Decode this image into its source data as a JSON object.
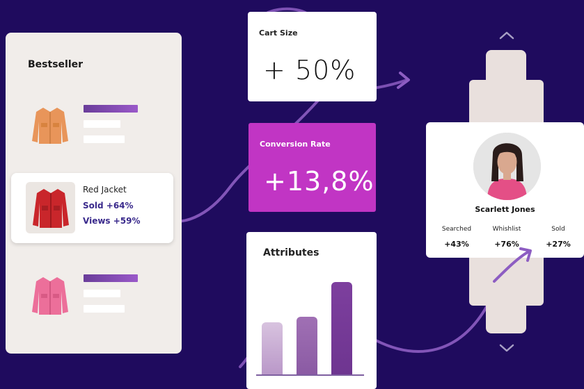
{
  "bestseller": {
    "title": "Bestseller",
    "featured": {
      "name": "Red Jacket",
      "sold": "Sold +64%",
      "views": "Views +59%"
    }
  },
  "cart_size": {
    "label": "Cart Size",
    "value": "+ 50%"
  },
  "conversion_rate": {
    "label": "Conversion Rate",
    "value": "+13,8%"
  },
  "attributes": {
    "title": "Attributes"
  },
  "profile": {
    "name": "Scarlett Jones",
    "stats": [
      {
        "label": "Searched",
        "value": "+43%"
      },
      {
        "label": "Whishlist",
        "value": "+76%"
      },
      {
        "label": "Sold",
        "value": "+27%"
      }
    ]
  },
  "icons": [
    "jacket-orange-icon",
    "jacket-red-icon",
    "jacket-pink-icon",
    "chevron-up-icon",
    "chevron-down-icon"
  ],
  "colors": {
    "background": "#1f0b5e",
    "conversion_card": "#c135c4",
    "accent_purple": "#7b4cae",
    "stat_text": "#3a2a8c"
  }
}
